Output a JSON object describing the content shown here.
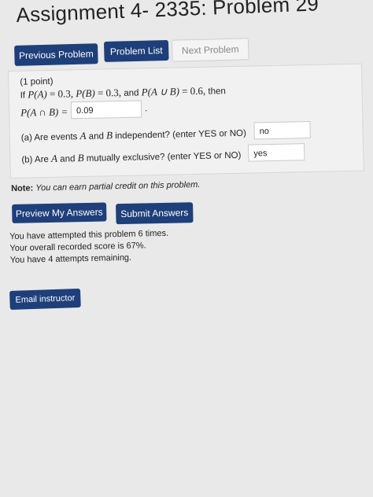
{
  "page": {
    "title": "Assignment 4- 2335: Problem 29"
  },
  "nav": {
    "previous": "Previous Problem",
    "list": "Problem List",
    "next": "Next Problem"
  },
  "problem": {
    "points": "(1 point)",
    "if_word": "If",
    "pa": "P(A)",
    "pa_val": "= 0.3,",
    "pb": "P(B)",
    "pb_val": "= 0.3,",
    "and_word": "and",
    "paub": "P(A ∪ B)",
    "paub_val": "= 0.6,",
    "then_word": "then",
    "pagb": "P(A ∩ B) =",
    "pagb_answer": "0.09",
    "period": ".",
    "part_a_prefix": "(a) Are events",
    "part_a_a": "A",
    "part_a_and": "and",
    "part_a_b": "B",
    "part_a_suffix": "independent? (enter YES or NO)",
    "part_a_answer": "no",
    "part_b_prefix": "(b) Are",
    "part_b_a": "A",
    "part_b_and": "and",
    "part_b_b": "B",
    "part_b_suffix": "mutually exclusive? (enter YES or NO)",
    "part_b_answer": "yes"
  },
  "note": {
    "label": "Note:",
    "text": "You can earn partial credit on this problem."
  },
  "actions": {
    "preview": "Preview My Answers",
    "submit": "Submit Answers"
  },
  "status": {
    "line1": "You have attempted this problem 6 times.",
    "line2": "Your overall recorded score is 67%.",
    "line3": "You have 4 attempts remaining."
  },
  "email": {
    "label": "Email instructor"
  }
}
